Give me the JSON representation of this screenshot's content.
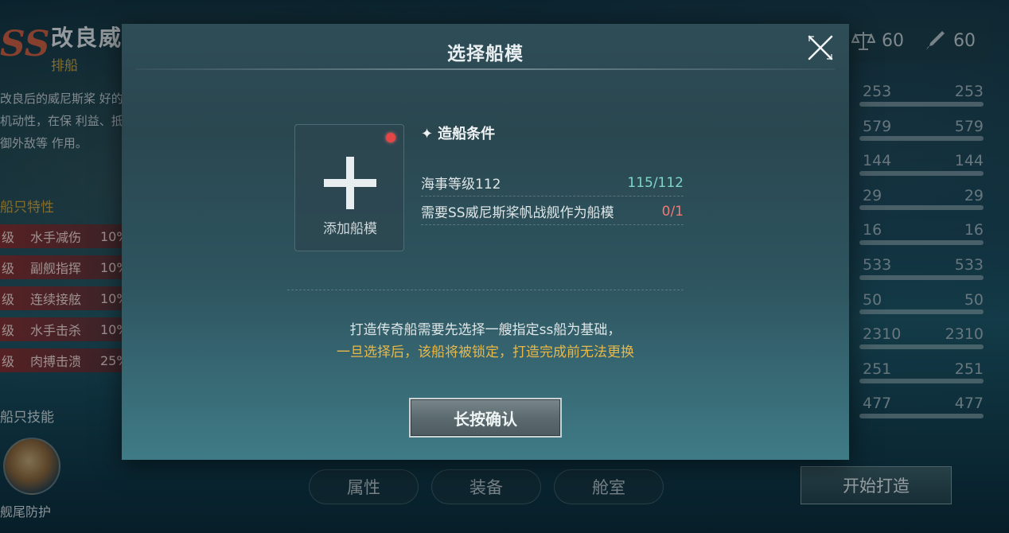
{
  "background": {
    "ship": {
      "badge": "SS",
      "name": "改良威",
      "class": "排船",
      "description": "改良后的威尼斯桨 好的机动性，在保 利益、抵御外敌等 作用。"
    },
    "features": {
      "title": "船只特性",
      "items": [
        {
          "level": "级",
          "name": "水手减伤",
          "value": "10%"
        },
        {
          "level": "级",
          "name": "副舰指挥",
          "value": "10%"
        },
        {
          "level": "级",
          "name": "连续接舷",
          "value": "10%"
        },
        {
          "level": "级",
          "name": "水手击杀",
          "value": "10%"
        },
        {
          "level": "级",
          "name": "肉搏击溃",
          "value": "25%"
        }
      ]
    },
    "skills": {
      "title": "船只技能",
      "skill_name": "舰尾防护",
      "icon": "ship-skill-icon"
    },
    "resources": [
      {
        "icon": "scale-icon",
        "value": "60"
      },
      {
        "icon": "brush-icon",
        "value": "60"
      }
    ],
    "stats": [
      {
        "current": "253",
        "max": "253"
      },
      {
        "current": "579",
        "max": "579"
      },
      {
        "current": "144",
        "max": "144"
      },
      {
        "current": "29",
        "max": "29"
      },
      {
        "current": "16",
        "max": "16"
      },
      {
        "current": "533",
        "max": "533"
      },
      {
        "current": "50",
        "max": "50"
      },
      {
        "current": "2310",
        "max": "2310"
      },
      {
        "current": "251",
        "max": "251"
      },
      {
        "current": "477",
        "max": "477"
      }
    ],
    "tabs": [
      "属性",
      "装备",
      "舱室"
    ],
    "start_build_label": "开始打造"
  },
  "modal": {
    "title": "选择船模",
    "close_icon": "close-icon",
    "add_slot": {
      "label": "添加船模",
      "has_notification": true
    },
    "conditions": {
      "title": "造船条件",
      "star": "✦",
      "items": [
        {
          "label": "海事等级112",
          "value": "115/112",
          "met": true
        },
        {
          "label": "需要SS威尼斯桨帆战舰作为船模",
          "value": "0/1",
          "met": false
        }
      ]
    },
    "notice_line1": "打造传奇船需要先选择一艘指定ss船为基础，",
    "notice_line2": "一旦选择后，该船将被锁定，打造完成前无法更换",
    "confirm_label": "长按确认"
  },
  "colors": {
    "accent_gold": "#e8b84a",
    "ok_green": "#7fd6c6",
    "fail_red": "#f07a74",
    "notification_red": "#e64545"
  }
}
